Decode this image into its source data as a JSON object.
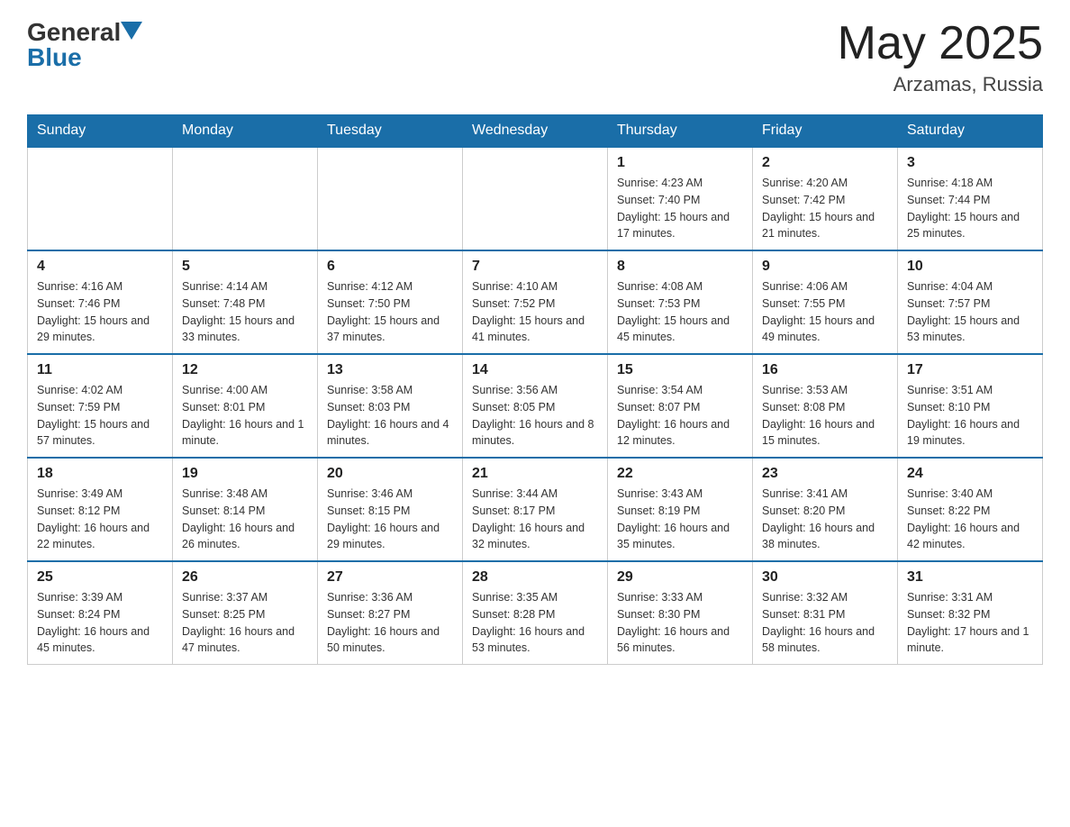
{
  "header": {
    "logo": {
      "general": "General",
      "triangle": "▲",
      "blue": "Blue"
    },
    "title": "May 2025",
    "location": "Arzamas, Russia"
  },
  "days_of_week": [
    "Sunday",
    "Monday",
    "Tuesday",
    "Wednesday",
    "Thursday",
    "Friday",
    "Saturday"
  ],
  "weeks": [
    [
      {
        "day": "",
        "info": ""
      },
      {
        "day": "",
        "info": ""
      },
      {
        "day": "",
        "info": ""
      },
      {
        "day": "",
        "info": ""
      },
      {
        "day": "1",
        "info": "Sunrise: 4:23 AM\nSunset: 7:40 PM\nDaylight: 15 hours and 17 minutes."
      },
      {
        "day": "2",
        "info": "Sunrise: 4:20 AM\nSunset: 7:42 PM\nDaylight: 15 hours and 21 minutes."
      },
      {
        "day": "3",
        "info": "Sunrise: 4:18 AM\nSunset: 7:44 PM\nDaylight: 15 hours and 25 minutes."
      }
    ],
    [
      {
        "day": "4",
        "info": "Sunrise: 4:16 AM\nSunset: 7:46 PM\nDaylight: 15 hours and 29 minutes."
      },
      {
        "day": "5",
        "info": "Sunrise: 4:14 AM\nSunset: 7:48 PM\nDaylight: 15 hours and 33 minutes."
      },
      {
        "day": "6",
        "info": "Sunrise: 4:12 AM\nSunset: 7:50 PM\nDaylight: 15 hours and 37 minutes."
      },
      {
        "day": "7",
        "info": "Sunrise: 4:10 AM\nSunset: 7:52 PM\nDaylight: 15 hours and 41 minutes."
      },
      {
        "day": "8",
        "info": "Sunrise: 4:08 AM\nSunset: 7:53 PM\nDaylight: 15 hours and 45 minutes."
      },
      {
        "day": "9",
        "info": "Sunrise: 4:06 AM\nSunset: 7:55 PM\nDaylight: 15 hours and 49 minutes."
      },
      {
        "day": "10",
        "info": "Sunrise: 4:04 AM\nSunset: 7:57 PM\nDaylight: 15 hours and 53 minutes."
      }
    ],
    [
      {
        "day": "11",
        "info": "Sunrise: 4:02 AM\nSunset: 7:59 PM\nDaylight: 15 hours and 57 minutes."
      },
      {
        "day": "12",
        "info": "Sunrise: 4:00 AM\nSunset: 8:01 PM\nDaylight: 16 hours and 1 minute."
      },
      {
        "day": "13",
        "info": "Sunrise: 3:58 AM\nSunset: 8:03 PM\nDaylight: 16 hours and 4 minutes."
      },
      {
        "day": "14",
        "info": "Sunrise: 3:56 AM\nSunset: 8:05 PM\nDaylight: 16 hours and 8 minutes."
      },
      {
        "day": "15",
        "info": "Sunrise: 3:54 AM\nSunset: 8:07 PM\nDaylight: 16 hours and 12 minutes."
      },
      {
        "day": "16",
        "info": "Sunrise: 3:53 AM\nSunset: 8:08 PM\nDaylight: 16 hours and 15 minutes."
      },
      {
        "day": "17",
        "info": "Sunrise: 3:51 AM\nSunset: 8:10 PM\nDaylight: 16 hours and 19 minutes."
      }
    ],
    [
      {
        "day": "18",
        "info": "Sunrise: 3:49 AM\nSunset: 8:12 PM\nDaylight: 16 hours and 22 minutes."
      },
      {
        "day": "19",
        "info": "Sunrise: 3:48 AM\nSunset: 8:14 PM\nDaylight: 16 hours and 26 minutes."
      },
      {
        "day": "20",
        "info": "Sunrise: 3:46 AM\nSunset: 8:15 PM\nDaylight: 16 hours and 29 minutes."
      },
      {
        "day": "21",
        "info": "Sunrise: 3:44 AM\nSunset: 8:17 PM\nDaylight: 16 hours and 32 minutes."
      },
      {
        "day": "22",
        "info": "Sunrise: 3:43 AM\nSunset: 8:19 PM\nDaylight: 16 hours and 35 minutes."
      },
      {
        "day": "23",
        "info": "Sunrise: 3:41 AM\nSunset: 8:20 PM\nDaylight: 16 hours and 38 minutes."
      },
      {
        "day": "24",
        "info": "Sunrise: 3:40 AM\nSunset: 8:22 PM\nDaylight: 16 hours and 42 minutes."
      }
    ],
    [
      {
        "day": "25",
        "info": "Sunrise: 3:39 AM\nSunset: 8:24 PM\nDaylight: 16 hours and 45 minutes."
      },
      {
        "day": "26",
        "info": "Sunrise: 3:37 AM\nSunset: 8:25 PM\nDaylight: 16 hours and 47 minutes."
      },
      {
        "day": "27",
        "info": "Sunrise: 3:36 AM\nSunset: 8:27 PM\nDaylight: 16 hours and 50 minutes."
      },
      {
        "day": "28",
        "info": "Sunrise: 3:35 AM\nSunset: 8:28 PM\nDaylight: 16 hours and 53 minutes."
      },
      {
        "day": "29",
        "info": "Sunrise: 3:33 AM\nSunset: 8:30 PM\nDaylight: 16 hours and 56 minutes."
      },
      {
        "day": "30",
        "info": "Sunrise: 3:32 AM\nSunset: 8:31 PM\nDaylight: 16 hours and 58 minutes."
      },
      {
        "day": "31",
        "info": "Sunrise: 3:31 AM\nSunset: 8:32 PM\nDaylight: 17 hours and 1 minute."
      }
    ]
  ]
}
